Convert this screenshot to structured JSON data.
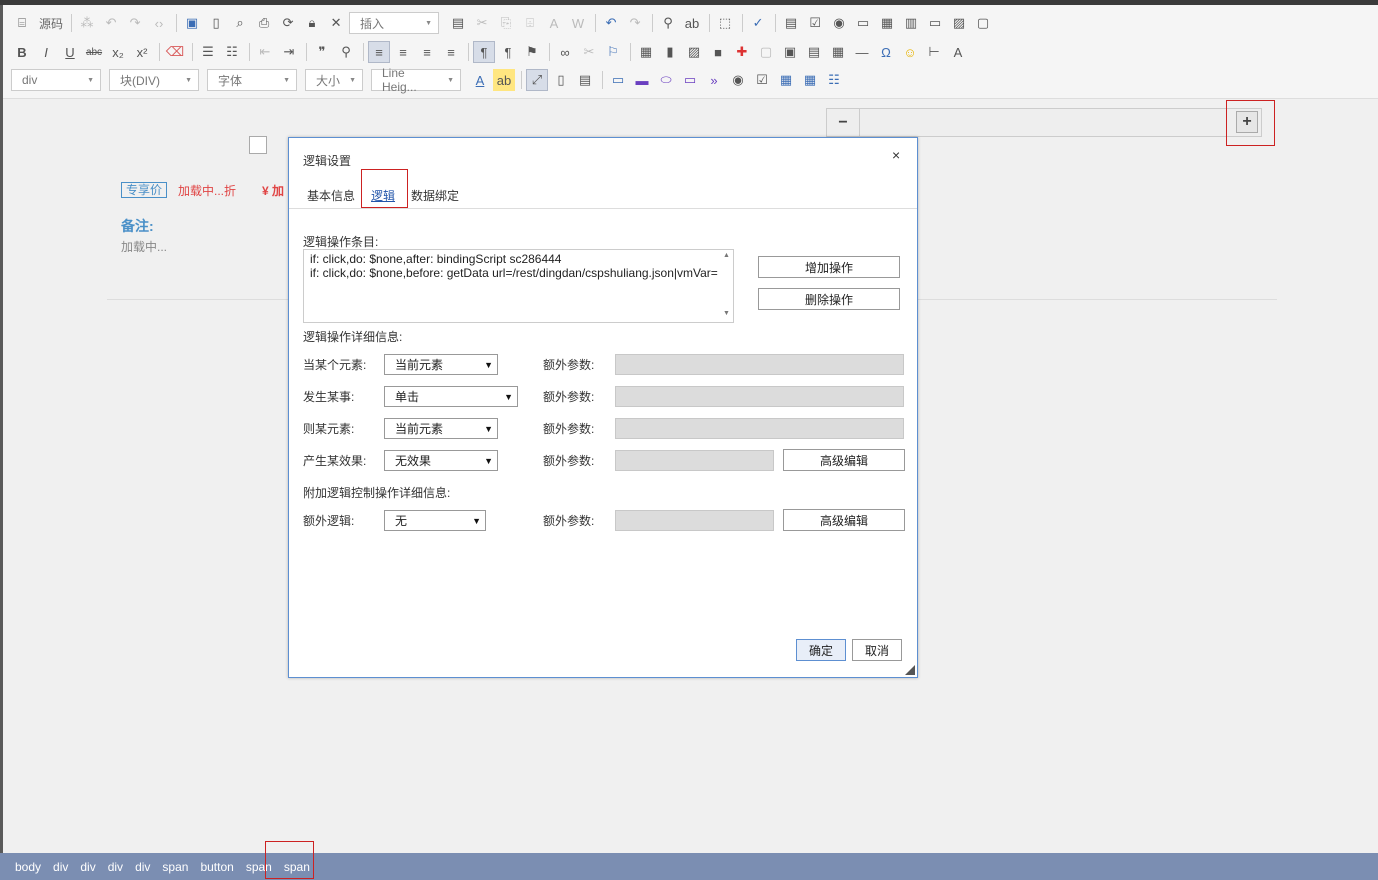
{
  "toolbar": {
    "source_label": "源码",
    "insert_select": "插入",
    "block_select": "div",
    "blocktype_select": "块(DIV)",
    "font_select": "字体",
    "size_select": "大小",
    "lineheight_select": "Line Heig..."
  },
  "canvas": {
    "price_tag": "专享价",
    "discount": "加载中...折",
    "price": "¥ 加",
    "note_label": "备注:",
    "note_text": "加载中...",
    "qty_minus": "−",
    "qty_plus": "+"
  },
  "statusbar": {
    "crumbs": [
      "body",
      "div",
      "div",
      "div",
      "div",
      "span",
      "button",
      "span",
      "span"
    ]
  },
  "dialog": {
    "title": "逻辑设置",
    "close": "×",
    "tabs": [
      "基本信息",
      "逻辑",
      "数据绑定"
    ],
    "active_tab": "逻辑",
    "list_label": "逻辑操作条目:",
    "list_items": [
      "if: click,do: $none,after: bindingScript sc286444",
      "if: click,do: $none,before: getData url=/rest/dingdan/cspshuliang.json|vmVar="
    ],
    "add_button": "增加操作",
    "delete_button": "删除操作",
    "detail_label": "逻辑操作详细信息:",
    "element_label": "当某个元素:",
    "element_value": "当前元素",
    "event_label": "发生某事:",
    "event_value": "单击",
    "target_label": "则某元素:",
    "target_value": "当前元素",
    "effect_label": "产生某效果:",
    "effect_value": "无效果",
    "extra_param_label": "额外参数:",
    "advanced_button": "高级编辑",
    "extra_detail_label": "附加逻辑控制操作详细信息:",
    "extra_logic_label": "额外逻辑:",
    "extra_logic_value": "无",
    "ok_button": "确定",
    "cancel_button": "取消"
  },
  "colors": {
    "statusbar_bg": "#7b8eb2",
    "dialog_border": "#5d8fd1",
    "highlight_red": "#cc2222",
    "accent_blue": "#4a90c8",
    "price_red": "#e04444"
  }
}
